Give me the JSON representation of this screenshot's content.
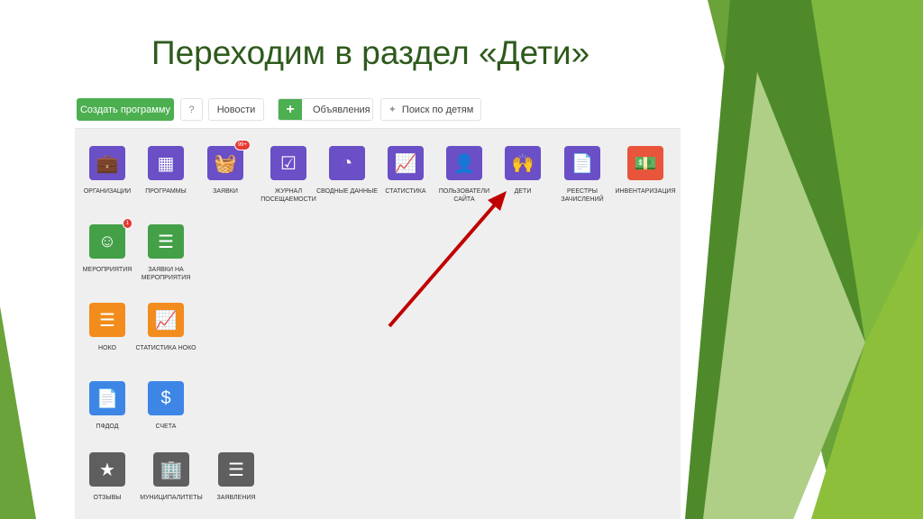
{
  "slide": {
    "title": "Переходим в раздел «Дети»"
  },
  "toolbar": {
    "create": "Создать программу",
    "help": "?",
    "news": "Новости",
    "add": "+",
    "ads": "Объявления",
    "search_kids": "Поиск по детям"
  },
  "tiles": [
    {
      "label": "Организации",
      "icon": "briefcase-icon",
      "glyph": "💼",
      "color": "purple"
    },
    {
      "label": "Программы",
      "icon": "calendar-icon",
      "glyph": "▦",
      "color": "purple"
    },
    {
      "label": "Заявки",
      "icon": "basket-icon",
      "glyph": "🧺",
      "color": "purple",
      "badge": "99+"
    },
    {
      "label": "Журнал посещаемости",
      "icon": "calendar-check-icon",
      "glyph": "☑",
      "color": "purple"
    },
    {
      "label": "Сводные данные",
      "icon": "gauge-icon",
      "glyph": "◔",
      "color": "purple"
    },
    {
      "label": "Статистика",
      "icon": "chart-icon",
      "glyph": "📈",
      "color": "purple"
    },
    {
      "label": "Пользователи сайта",
      "icon": "user-icon",
      "glyph": "👤",
      "color": "purple"
    },
    {
      "label": "Дети",
      "icon": "child-icon",
      "glyph": "🙌",
      "color": "purple"
    },
    {
      "label": "Реестры зачислений",
      "icon": "certificate-icon",
      "glyph": "📄",
      "color": "purple"
    },
    {
      "label": "Инвентаризация",
      "icon": "money-icon",
      "glyph": "💵",
      "color": "red"
    },
    {
      "label": "Мероприятия",
      "icon": "smile-icon",
      "glyph": "☺",
      "color": "green2",
      "badge": "1"
    },
    {
      "label": "Заявки на мероприятия",
      "icon": "list-icon",
      "glyph": "☰",
      "color": "green2"
    },
    {
      "label": "НОКО",
      "icon": "list-icon",
      "glyph": "☰",
      "color": "orange"
    },
    {
      "label": "Статистика НОКО",
      "icon": "chart-icon",
      "glyph": "📈",
      "color": "orange"
    },
    {
      "label": "ПФДОД",
      "icon": "certificate-icon",
      "glyph": "📄",
      "color": "blue"
    },
    {
      "label": "Счета",
      "icon": "invoice-icon",
      "glyph": "$",
      "color": "blue"
    },
    {
      "label": "Отзывы",
      "icon": "star-icon",
      "glyph": "★",
      "color": "gray"
    },
    {
      "label": "Муниципалитеты",
      "icon": "building-icon",
      "glyph": "🏢",
      "color": "gray"
    },
    {
      "label": "Заявления",
      "icon": "list-icon",
      "glyph": "☰",
      "color": "gray"
    }
  ],
  "colors": {
    "arrow": "#c00000",
    "title": "#2e5a1c"
  }
}
